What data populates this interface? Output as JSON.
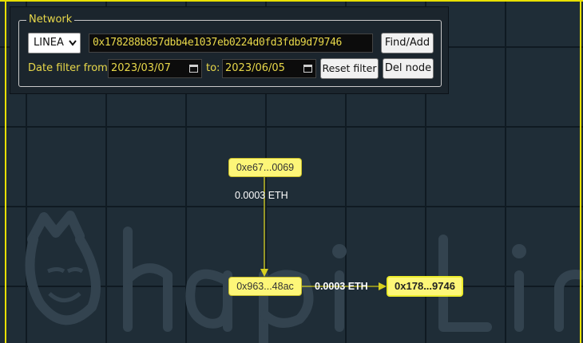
{
  "panel": {
    "legend": "Network",
    "network_select": "LINEA",
    "address_value": "0x178288b857dbb4e1037eb0224d0fd3fdb9d79746",
    "find_add_label": "Find/Add",
    "date_filter_label": "Date filter from:",
    "date_from": "2023/03/07",
    "to_label": "to:",
    "date_to": "2023/06/05",
    "reset_filter_label": "Reset filter",
    "del_node_label": "Del node"
  },
  "graph": {
    "nodes": [
      {
        "id": "a",
        "label": "0xe67...0069"
      },
      {
        "id": "b",
        "label": "0x963...48ac"
      },
      {
        "id": "c",
        "label": "0x178...9746"
      }
    ],
    "edges": [
      {
        "from": "a",
        "to": "b",
        "label": "0.0003 ETH"
      },
      {
        "from": "b",
        "to": "c",
        "label": "0.0003 ETH"
      }
    ]
  },
  "colors": {
    "accent": "#e8d84a",
    "node_fill": "#fdf678",
    "edge": "#d8d020",
    "background": "#1f2d37"
  },
  "icons": {
    "select_chevron": "chevron-down-icon",
    "date_picker": "calendar-icon",
    "watermark_logo": "hapi-logo"
  }
}
